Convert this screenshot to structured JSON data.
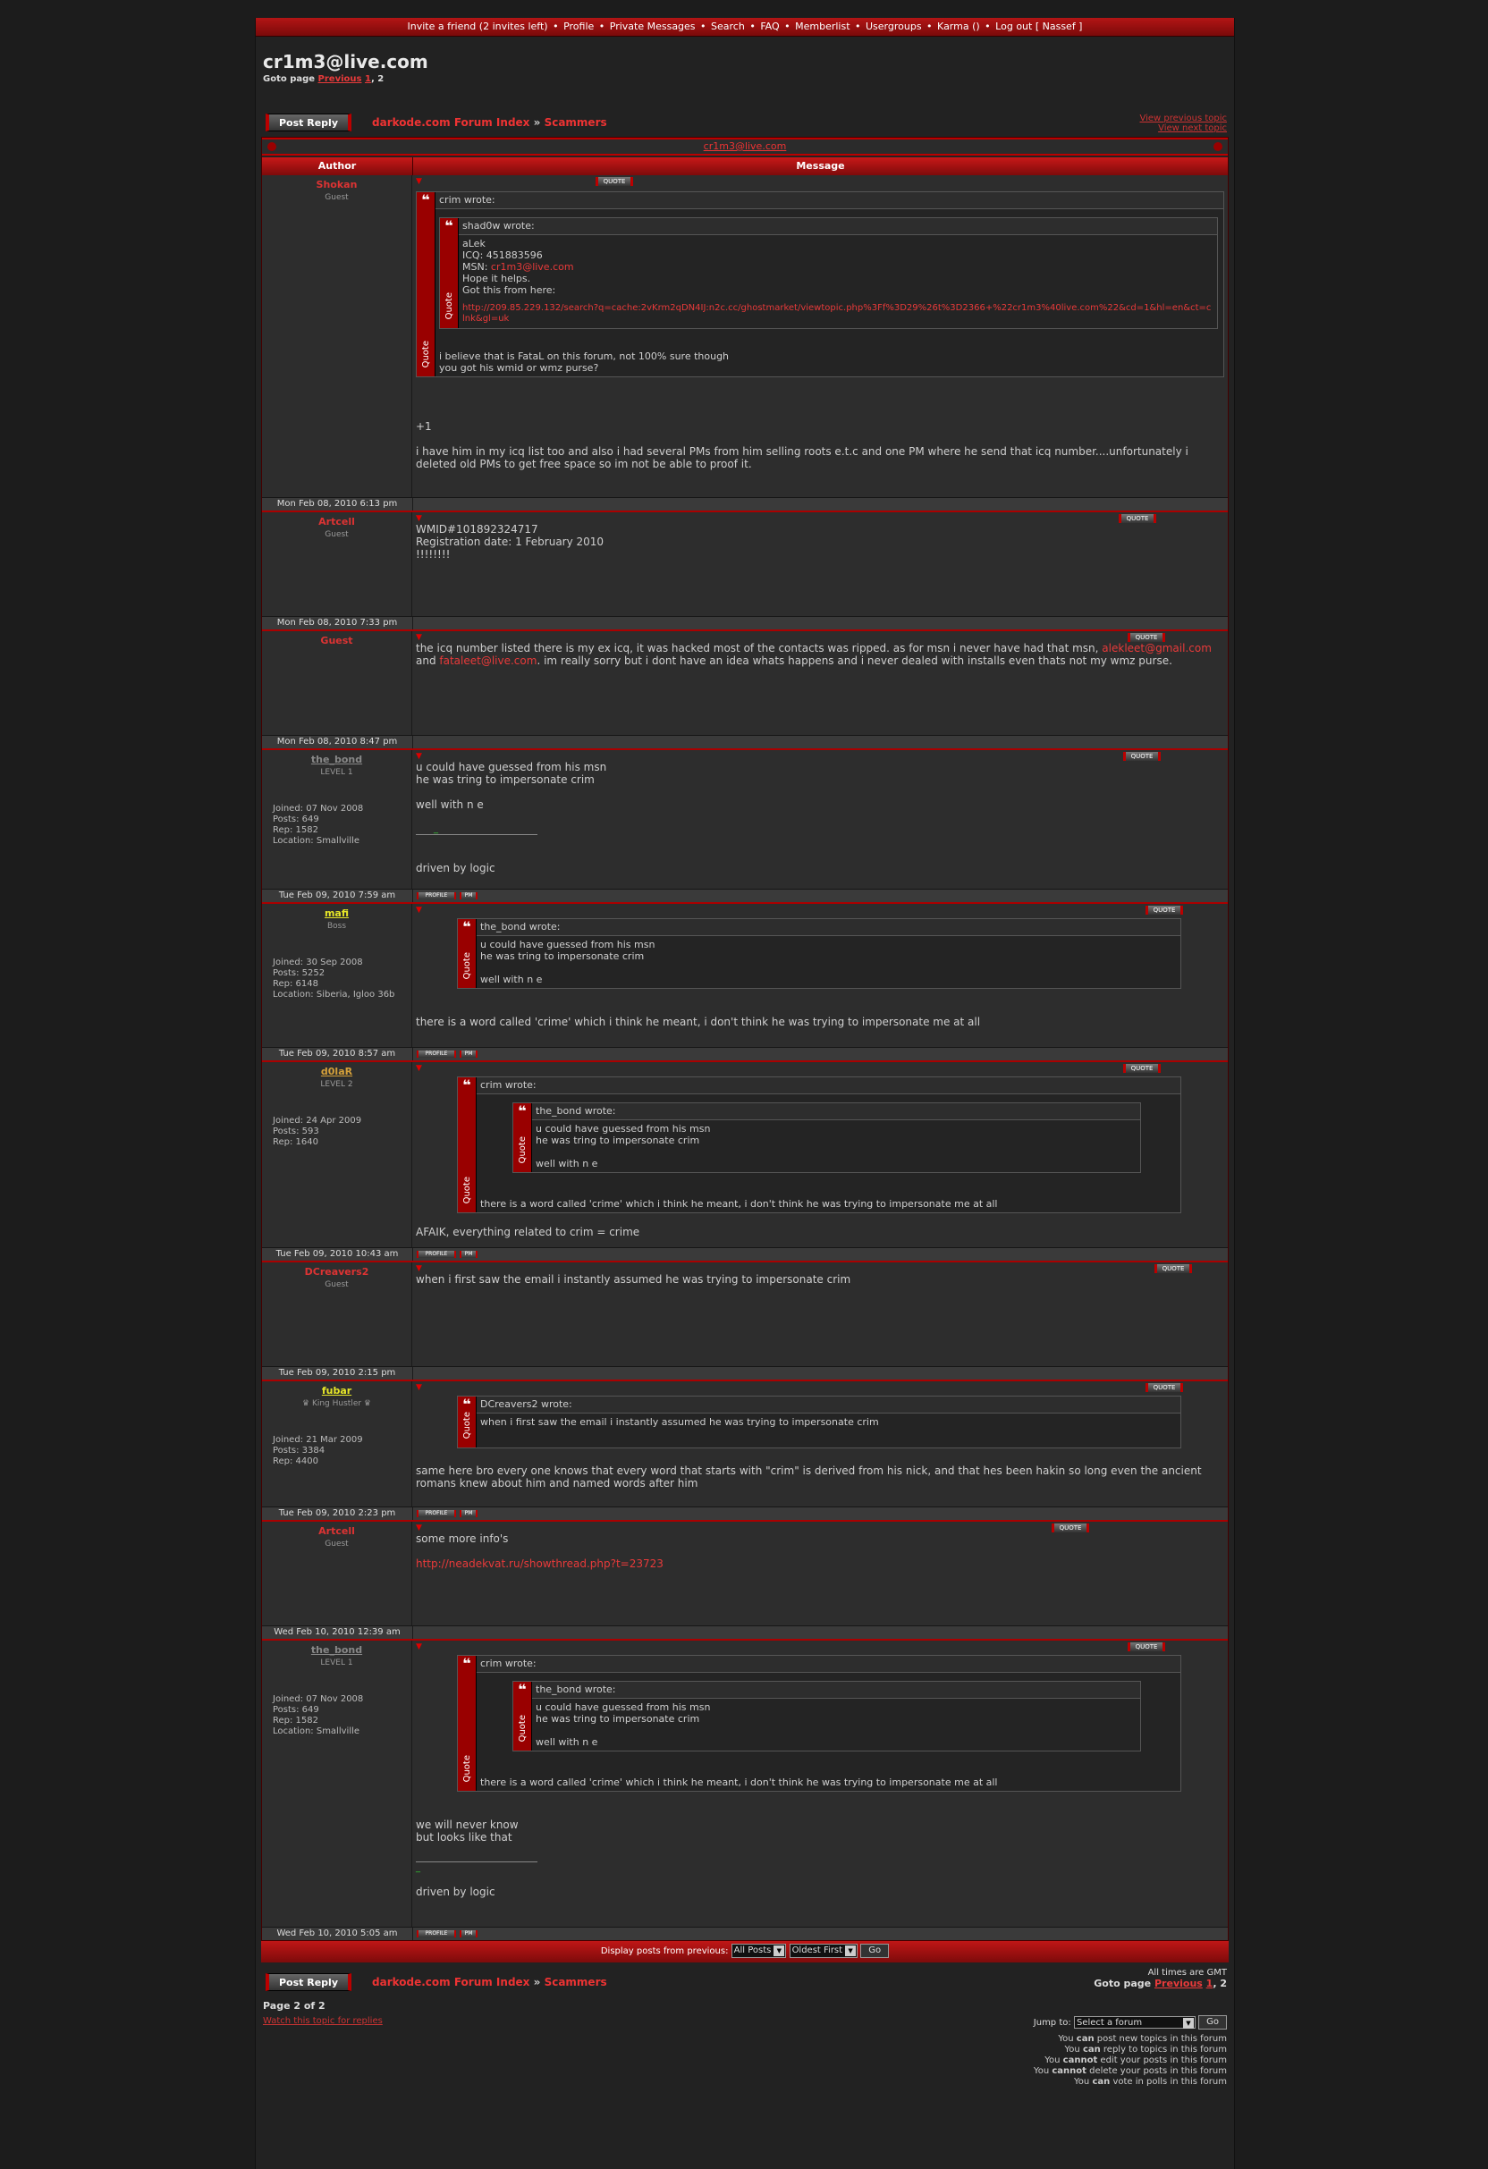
{
  "topnav": {
    "invite": "Invite a friend (2 invites left)",
    "profile": "Profile",
    "pm": "Private Messages",
    "search": "Search",
    "faq": "FAQ",
    "memberlist": "Memberlist",
    "usergroups": "Usergroups",
    "karma": "Karma ()",
    "logout": "Log out [ Nassef ]"
  },
  "page": {
    "title": "cr1m3@live.com",
    "goto_label": "Goto page",
    "prev": "Previous",
    "p1": "1",
    "p2": "2"
  },
  "crumb": {
    "post_reply": "Post Reply",
    "forum_index": "darkode.com Forum Index",
    "sep": "»",
    "forum": "Scammers",
    "view_prev": "View previous topic",
    "view_next": "View next topic"
  },
  "topic_title": "cr1m3@live.com",
  "cols": {
    "author": "Author",
    "message": "Message"
  },
  "buttons": {
    "quote": "QUOTE",
    "profile": "PROFILE",
    "pm": "PM",
    "quote_label": "Quote"
  },
  "posts": [
    {
      "author": "Shokan",
      "rank": "Guest",
      "date": "Mon Feb 08, 2010 6:13 pm",
      "q1_head": "crim wrote:",
      "q2_head": "shad0w wrote:",
      "q2_l1": "aLek",
      "q2_l2": "ICQ: 451883596",
      "q2_l3a": "MSN: ",
      "q2_l3b": "cr1m3@live.com",
      "q2_l4": "Hope it helps.",
      "q2_l5": "Got this from here:",
      "q2_link": "http://209.85.229.132/search?q=cache:2vKrm2qDN4IJ:n2c.cc/ghostmarket/viewtopic.php%3Ff%3D29%26t%3D2366+%22cr1m3%40live.com%22&cd=1&hl=en&ct=clnk&gl=uk",
      "q1_l1": "i believe that is FataL on this forum, not 100% sure though",
      "q1_l2": "you got his wmid or wmz purse?",
      "t1": "+1",
      "t2": "i have him in my icq list too and also i had several PMs from him selling roots e.t.c and one PM where he send that icq number....unfortunately i deleted old PMs to get free space so im not be able to proof it."
    },
    {
      "author": "Artcell",
      "rank": "Guest",
      "date": "Mon Feb 08, 2010 7:33 pm",
      "l1": "WMID#101892324717",
      "l2": "Registration date: 1 February 2010",
      "l3": "!!!!!!!!"
    },
    {
      "author": "Guest",
      "rank": "",
      "date": "Mon Feb 08, 2010 8:47 pm",
      "t1": "the icq number listed there is my ex icq, it was hacked most of the contacts was ripped. as for msn i never have had that msn,",
      "e1": "alekleet@gmail.com",
      "and": " and ",
      "e2": "fataleet@live.com",
      "t2": ". im really sorry but i dont have an idea whats happens and i never dealed with installs even thats not my wmz purse."
    },
    {
      "author": "the_bond",
      "rank": "LEVEL 1",
      "joined": "Joined: 07 Nov 2008",
      "posts": "Posts: 649",
      "rep": "Rep: 1582",
      "loc": "Location: Smallville",
      "date": "Tue Feb 09, 2010 7:59 am",
      "l1": "u could have guessed from his msn",
      "l2": "he was tring to impersonate crim",
      "l3": "well with n e",
      "sig1": "_",
      "sig2": "driven by logic"
    },
    {
      "author": "mafi",
      "rank": "Boss",
      "joined": "Joined: 30 Sep 2008",
      "posts": "Posts: 5252",
      "rep": "Rep: 6148",
      "loc": "Location: Siberia, Igloo 36b",
      "date": "Tue Feb 09, 2010 8:57 am",
      "q_head": "the_bond wrote:",
      "q_l1": "u could have guessed from his msn",
      "q_l2": "he was tring to impersonate crim",
      "q_l3": "well with n e",
      "t1": "there is a word called 'crime' which i think he meant, i don't think he was trying to impersonate me at all"
    },
    {
      "author": "d0laR",
      "rank": "LEVEL 2",
      "joined": "Joined: 24 Apr 2009",
      "posts": "Posts: 593",
      "rep": "Rep: 1640",
      "date": "Tue Feb 09, 2010 10:43 am",
      "q1_head": "crim wrote:",
      "q2_head": "the_bond wrote:",
      "q2_l1": "u could have guessed from his msn",
      "q2_l2": "he was tring to impersonate crim",
      "q2_l3": "well with n e",
      "q1_l1": "there is a word called 'crime' which i think he meant, i don't think he was trying to impersonate me at all",
      "t1": "AFAIK, everything related to crim = crime"
    },
    {
      "author": "DCreavers2",
      "rank": "Guest",
      "date": "Tue Feb 09, 2010 2:15 pm",
      "t1": "when i first saw the email i instantly assumed he was trying to impersonate crim"
    },
    {
      "author": "fubar",
      "rank": "♛ King Hustler ♛",
      "joined": "Joined: 21 Mar 2009",
      "posts": "Posts: 3384",
      "rep": "Rep: 4400",
      "date": "Tue Feb 09, 2010 2:23 pm",
      "q_head": "DCreavers2 wrote:",
      "q_l1": "when i first saw the email i instantly assumed he was trying to impersonate crim",
      "t1": "same here bro every one knows that every word that starts with \"crim\" is derived from his nick, and that hes been hakin so long even the ancient romans knew about him and named words after him"
    },
    {
      "author": "Artcell",
      "rank": "Guest",
      "date": "Wed Feb 10, 2010 12:39 am",
      "t1": "some more info's",
      "link": "http://neadekvat.ru/showthread.php?t=23723"
    },
    {
      "author": "the_bond",
      "rank": "LEVEL 1",
      "joined": "Joined: 07 Nov 2008",
      "posts": "Posts: 649",
      "rep": "Rep: 1582",
      "loc": "Location: Smallville",
      "date": "Wed Feb 10, 2010 5:05 am",
      "q1_head": "crim wrote:",
      "q2_head": "the_bond wrote:",
      "q2_l1": "u could have guessed from his msn",
      "q2_l2": "he was tring to impersonate crim",
      "q2_l3": "well with n e",
      "q1_l1": "there is a word called 'crime' which i think he meant, i don't think he was trying to impersonate me at all",
      "t1": "we will never know",
      "t2": "but looks like that",
      "sig1": "_",
      "sig2": "driven by logic"
    }
  ],
  "footer": {
    "display_label": "Display posts from previous:",
    "all_posts": "All Posts",
    "oldest": "Oldest First",
    "go": "Go",
    "times": "All times are GMT",
    "goto_label": "Goto page",
    "prev": "Previous",
    "p1": "1",
    "p2": "2",
    "page_of": "Page 2 of 2",
    "watch": "Watch this topic for replies",
    "jump": "Jump to:",
    "select_forum": "Select a forum",
    "go2": "Go"
  },
  "perms": {
    "you": "You",
    "can": "can",
    "cannot": "cannot",
    "l1": " post new topics in this forum",
    "l2": " reply to topics in this forum",
    "l3": " edit your posts in this forum",
    "l4": " delete your posts in this forum",
    "l5": " vote in polls in this forum"
  }
}
